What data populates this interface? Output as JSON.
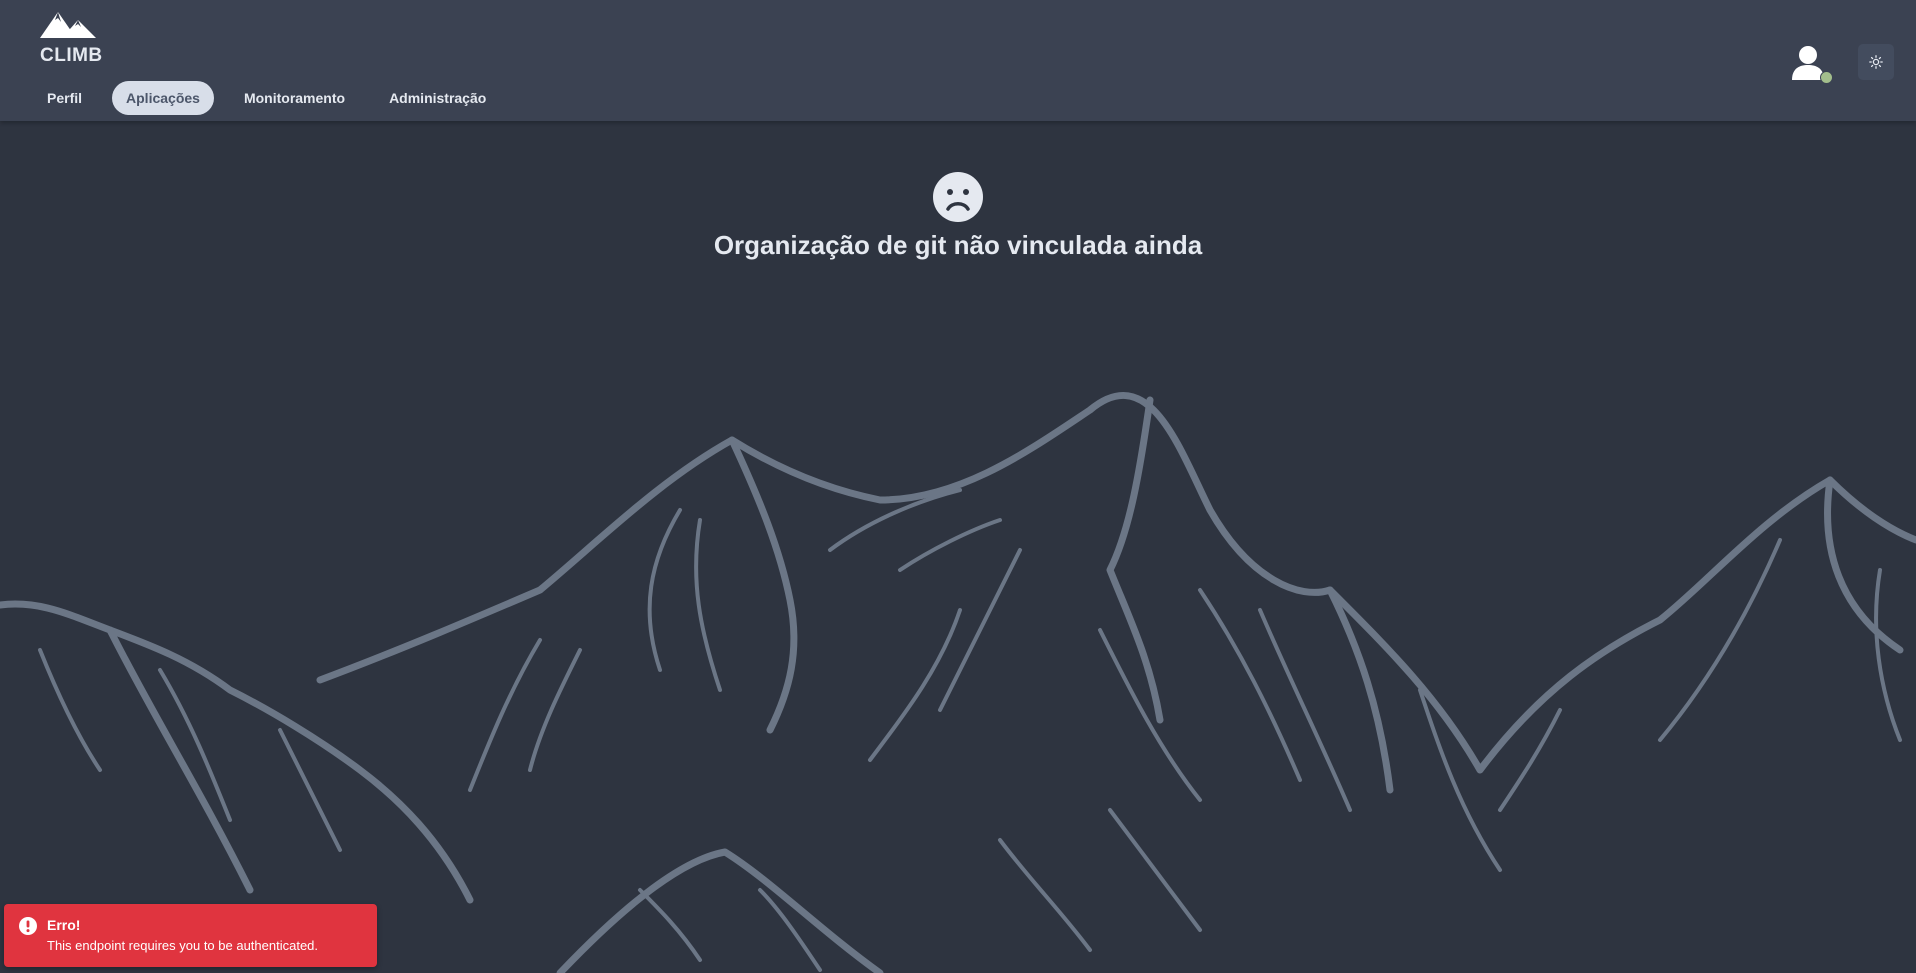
{
  "app": {
    "logo_text": "CLIMB"
  },
  "nav": {
    "items": [
      {
        "label": "Perfil",
        "active": false
      },
      {
        "label": "Aplicações",
        "active": true
      },
      {
        "label": "Monitoramento",
        "active": false
      },
      {
        "label": "Administração",
        "active": false
      }
    ]
  },
  "header_right": {
    "avatar_icon": "user-icon",
    "status": "online",
    "theme_toggle_icon": "sun-icon"
  },
  "empty_state": {
    "icon": "sad-face-icon",
    "title": "Organização de git não vinculada ainda"
  },
  "toast": {
    "icon": "exclamation-circle-icon",
    "title": "Erro!",
    "message": "This endpoint requires you to be authenticated."
  },
  "colors": {
    "background": "#2e3440",
    "header": "#3b4252",
    "mountain_lines": "#6b7686",
    "active_tab": "#d8dee9",
    "status_online": "#a3be8c",
    "toast_error": "#e0343f"
  }
}
